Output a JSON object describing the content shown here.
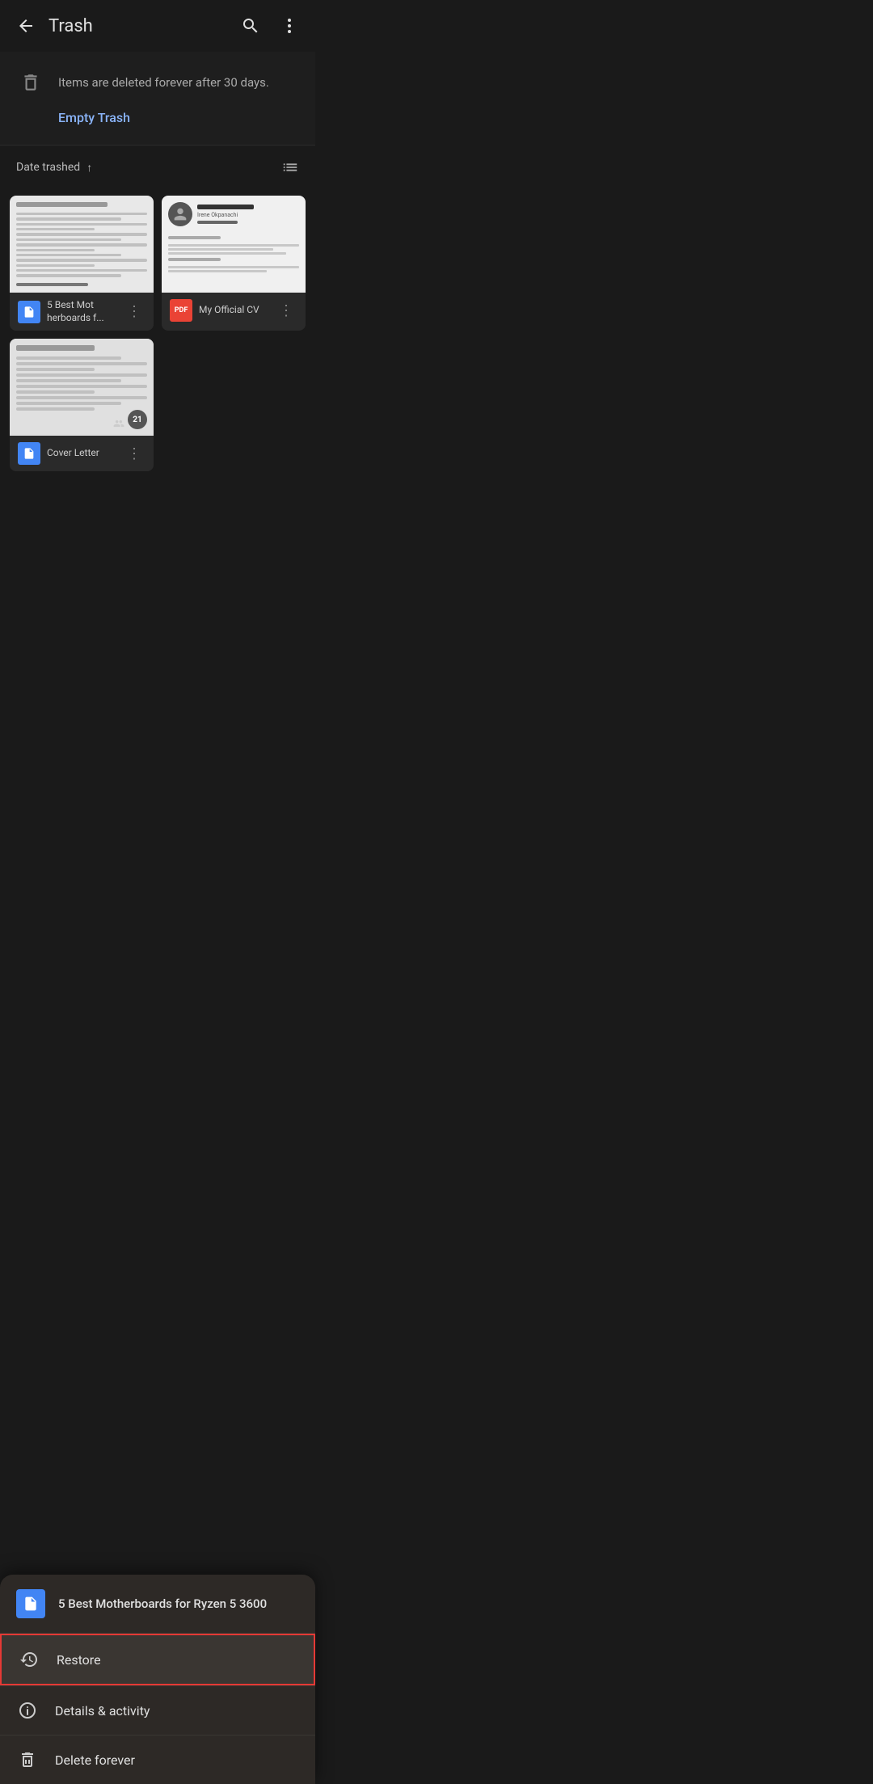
{
  "header": {
    "title": "Trash",
    "back_label": "back",
    "search_label": "search",
    "more_label": "more options"
  },
  "info_bar": {
    "info_text": "Items are deleted forever after 30 days.",
    "empty_trash_label": "Empty Trash"
  },
  "sort_bar": {
    "sort_label": "Date trashed",
    "sort_direction": "ascending"
  },
  "files": [
    {
      "id": "file1",
      "name": "5 Best Mot herboards f...",
      "full_name": "5 Best Motherboards for Ryzen 5 3600",
      "type": "doc",
      "type_label": "Google Doc"
    },
    {
      "id": "file2",
      "name": "My Official CV",
      "full_name": "My Official CV",
      "type": "pdf",
      "type_label": "PDF"
    },
    {
      "id": "file3",
      "name": "Cover Letter",
      "full_name": "Cover Letter",
      "type": "doc",
      "type_label": "Google Doc",
      "comment_count": "21"
    }
  ],
  "bottom_sheet": {
    "file_name": "5 Best Motherboards for Ryzen 5 3600",
    "file_type": "doc",
    "menu_items": [
      {
        "id": "restore",
        "label": "Restore",
        "icon": "restore-icon",
        "highlighted": true
      },
      {
        "id": "details",
        "label": "Details & activity",
        "icon": "info-icon",
        "highlighted": false
      },
      {
        "id": "delete",
        "label": "Delete forever",
        "icon": "delete-forever-icon",
        "highlighted": false
      }
    ]
  }
}
